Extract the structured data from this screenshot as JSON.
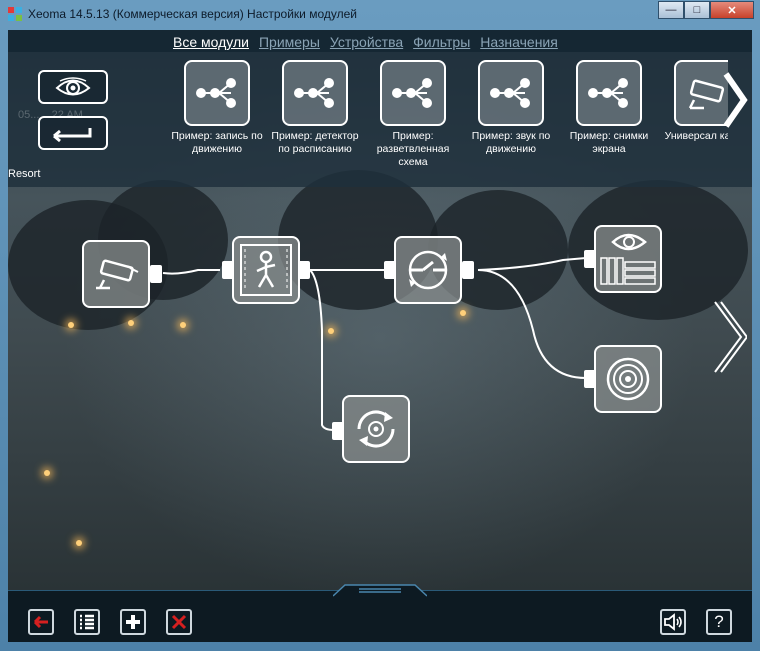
{
  "window": {
    "title": "Xeoma 14.5.13 (Коммерческая версия) Настройки модулей",
    "minimize_icon": "minimize-icon",
    "maximize_icon": "maximize-icon",
    "close_icon": "close-icon"
  },
  "nav": {
    "tabs": [
      {
        "label": "Все модули",
        "active": true
      },
      {
        "label": "Примеры",
        "active": false
      },
      {
        "label": "Устройства",
        "active": false
      },
      {
        "label": "Фильтры",
        "active": false
      },
      {
        "label": "Назначения",
        "active": false
      }
    ]
  },
  "sidebar": {
    "eye_icon": "eye-icon",
    "back_icon": "return-arrow-icon",
    "resort_label": "Resort",
    "timestamp_ghost": "05... ...22 AM"
  },
  "templates": [
    {
      "label": "Пример: запись по движению",
      "icon": "chain-icon"
    },
    {
      "label": "Пример: детектор по расписанию",
      "icon": "chain-icon"
    },
    {
      "label": "Пример: разветвленная схема",
      "icon": "chain-icon"
    },
    {
      "label": "Пример: звук по движению",
      "icon": "chain-icon"
    },
    {
      "label": "Пример: снимки экрана",
      "icon": "chain-icon"
    },
    {
      "label": "Универсал камер",
      "icon": "camera-icon"
    }
  ],
  "modules": [
    {
      "name": "universal-camera",
      "icon": "camera-icon"
    },
    {
      "name": "motion-detector",
      "icon": "walking-person-icon"
    },
    {
      "name": "scheduler",
      "icon": "scheduler-icon"
    },
    {
      "name": "preview-archive",
      "icon": "eye-archive-icon"
    },
    {
      "name": "sound-alarm",
      "icon": "speaker-icon"
    },
    {
      "name": "http-switcher",
      "icon": "circular-arrows-icon"
    }
  ],
  "bottom": {
    "exit_icon": "red-arrow-left-icon",
    "list_icon": "list-icon",
    "add_icon": "plus-icon",
    "delete_icon": "red-x-icon",
    "sound_icon": "sound-icon",
    "help_label": "?"
  },
  "colors": {
    "accent_blue": "#4a86ad",
    "delete_red": "#d62020",
    "tab_active": "#ffffff",
    "tab_inactive": "#8aa3b5"
  }
}
